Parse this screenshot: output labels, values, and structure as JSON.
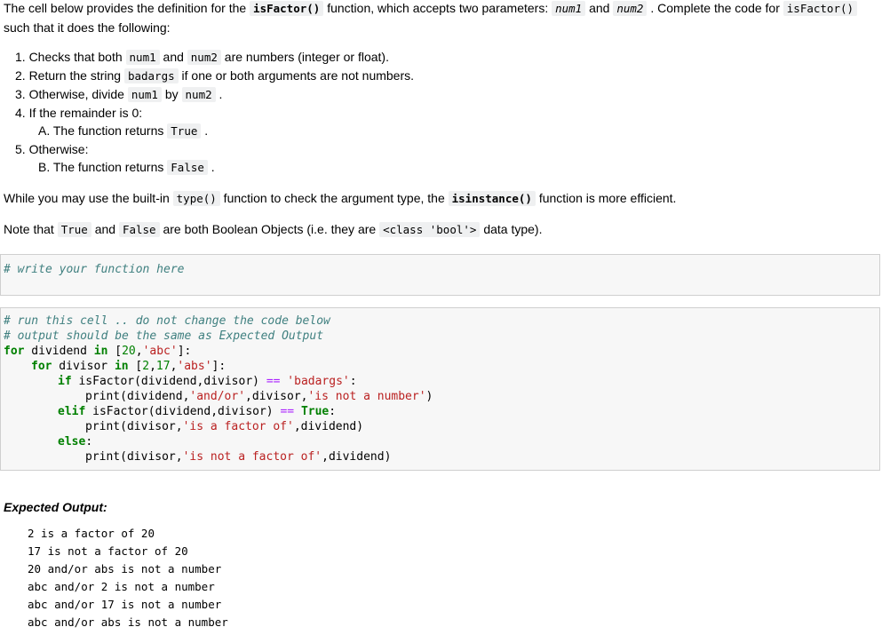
{
  "intro": {
    "p1_a": "The cell below provides the definition for the ",
    "p1_fn": "isFactor()",
    "p1_b": " function, which accepts two parameters: ",
    "p1_num1": "num1",
    "p1_c": " and ",
    "p1_num2": "num2",
    "p1_d": " . Complete the code for ",
    "p1_fn2": "isFactor()",
    "p1_e": "such that it does the following:"
  },
  "steps": {
    "s1_a": "1. Checks that both ",
    "s1_num1": "num1",
    "s1_and": " and ",
    "s1_num2": "num2",
    "s1_b": " are numbers (integer or float).",
    "s2_a": "2. Return the string ",
    "s2_code": "badargs",
    "s2_b": " if one or both arguments are not numbers.",
    "s3_a": "3. Otherwise, divide ",
    "s3_num1": "num1",
    "s3_by": " by ",
    "s3_num2": "num2",
    "s3_b": " .",
    "s4": "4. If the remainder is 0:",
    "s4a_a": "A. The function returns ",
    "s4a_code": "True",
    "s4a_b": " .",
    "s5": "5. Otherwise:",
    "s5b_a": "B. The function returns ",
    "s5b_code": "False",
    "s5b_b": " ."
  },
  "notes": {
    "n1_a": "While you may use the built-in ",
    "n1_code1": "type()",
    "n1_b": " function to check the argument type, the ",
    "n1_code2": "isinstance()",
    "n1_c": " function is more efficient.",
    "n2_a": "Note that ",
    "n2_true": "True",
    "n2_and": " and ",
    "n2_false": "False",
    "n2_b": " are both Boolean Objects (i.e. they are ",
    "n2_code": "<class 'bool'>",
    "n2_c": " data type)."
  },
  "cell1": {
    "comment": "# write your function here"
  },
  "cell2": {
    "l1": "# run this cell .. do not change the code below",
    "l2": "# output should be the same as Expected Output",
    "l3_kw1": "for",
    "l3_a": " dividend ",
    "l3_kw2": "in",
    "l3_b": " [",
    "l3_n1": "20",
    "l3_c": ",",
    "l3_s1": "'abc'",
    "l3_d": "]:",
    "l4_kw1": "for",
    "l4_a": " divisor ",
    "l4_kw2": "in",
    "l4_b": " [",
    "l4_n1": "2",
    "l4_c": ",",
    "l4_n2": "17",
    "l4_d": ",",
    "l4_s1": "'abs'",
    "l4_e": "]:",
    "l5_kw": "if",
    "l5_a": " isFactor(dividend,divisor) ",
    "l5_op": "==",
    "l5_b": " ",
    "l5_s": "'badargs'",
    "l5_c": ":",
    "l6_a": "print(dividend,",
    "l6_s1": "'and/or'",
    "l6_b": ",divisor,",
    "l6_s2": "'is not a number'",
    "l6_c": ")",
    "l7_kw": "elif",
    "l7_a": " isFactor(dividend,divisor) ",
    "l7_op": "==",
    "l7_b": " ",
    "l7_kw2": "True",
    "l7_c": ":",
    "l8_a": "print(divisor,",
    "l8_s": "'is a factor of'",
    "l8_b": ",dividend)",
    "l9_kw": "else",
    "l9_a": ":",
    "l10_a": "print(divisor,",
    "l10_s": "'is not a factor of'",
    "l10_b": ",dividend)"
  },
  "expected": {
    "title": "Expected Output:",
    "lines": [
      "2 is a factor of 20",
      "17 is not a factor of 20",
      "20 and/or abs is not a number",
      "abc and/or 2 is not a number",
      "abc and/or 17 is not a number",
      "abc and/or abs is not a number"
    ]
  }
}
